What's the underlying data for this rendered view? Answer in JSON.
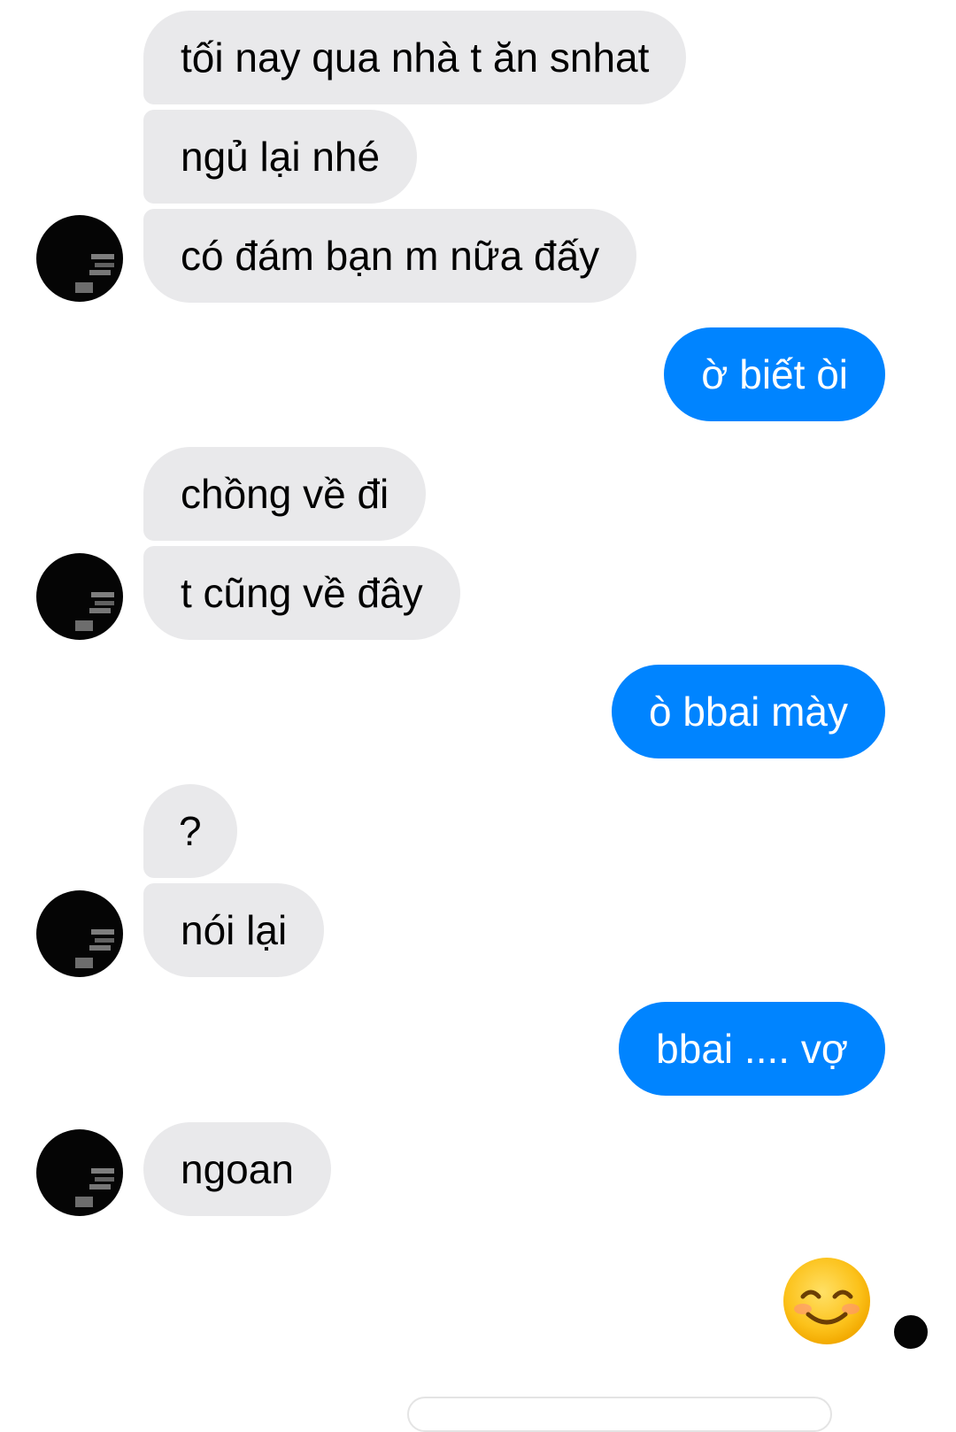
{
  "colors": {
    "incoming_bubble": "#e9e9eb",
    "outgoing_bubble": "#0084ff",
    "incoming_text": "#000000",
    "outgoing_text": "#ffffff"
  },
  "messages": [
    {
      "from": "them",
      "text": "tối nay qua nhà t ăn snhat"
    },
    {
      "from": "them",
      "text": "ngủ lại nhé"
    },
    {
      "from": "them",
      "text": "có đám bạn m nữa đấy"
    },
    {
      "from": "me",
      "text": "ờ biết òi"
    },
    {
      "from": "them",
      "text": "chồng về đi"
    },
    {
      "from": "them",
      "text": "t cũng về đây"
    },
    {
      "from": "me",
      "text": "ò bbai mày"
    },
    {
      "from": "them",
      "text": "?"
    },
    {
      "from": "them",
      "text": "nói lại"
    },
    {
      "from": "me",
      "text": "bbai .... vợ"
    },
    {
      "from": "them",
      "text": "ngoan"
    },
    {
      "from": "me",
      "emoji": "smiling-face-with-smiling-eyes-icon"
    }
  ],
  "icons": {
    "contact_avatar": "contact-avatar",
    "read_receipt": "read-receipt-avatar"
  }
}
